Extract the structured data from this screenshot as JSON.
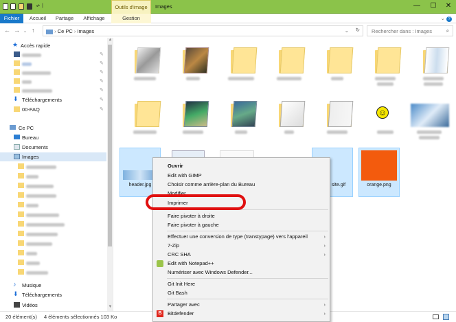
{
  "titlebar": {
    "context_tab": "Outils d'image",
    "title": "Images"
  },
  "ribbon": {
    "tabs": [
      "Fichier",
      "Accueil",
      "Partage",
      "Affichage",
      "Gestion"
    ]
  },
  "address": {
    "path_root": "Ce PC",
    "path_sep": "›",
    "path_current": "Images",
    "search_placeholder": "Rechercher dans : Images"
  },
  "sidebar": {
    "quick_access": "Accès rapide",
    "downloads": "Téléchargements",
    "faq": "00-FAQ",
    "this_pc": "Ce PC",
    "desktop": "Bureau",
    "documents": "Documents",
    "images": "Images",
    "music": "Musique",
    "downloads2": "Téléchargements",
    "videos": "Vidéos"
  },
  "files": {
    "f1": "header.jpg",
    "f2": "site.gif",
    "f3": "orange.png"
  },
  "status": {
    "count": "20 élément(s)",
    "selection": "4 éléments sélectionnés  103 Ko"
  },
  "menu": {
    "open": "Ouvrir",
    "gimp": "Edit with GIMP",
    "wallpaper": "Choisir comme arrière-plan du Bureau",
    "modify": "Modifier",
    "print": "Imprimer",
    "rot_right": "Faire pivoter à droite",
    "rot_left": "Faire pivoter à gauche",
    "convert": "Effectuer une conversion de type (transtypage) vers l'appareil",
    "zip": "7-Zip",
    "crc": "CRC SHA",
    "notepad": "Edit with Notepad++",
    "defender": "Numériser avec Windows Defender...",
    "git_init": "Git Init Here",
    "git_bash": "Git Bash",
    "share": "Partager avec",
    "bitdefender": "Bitdefender"
  },
  "colors": {
    "titlebar": "#8bc34a",
    "file_tab": "#1979ca",
    "highlight_ring": "#e01010",
    "selection": "#cce8ff"
  }
}
